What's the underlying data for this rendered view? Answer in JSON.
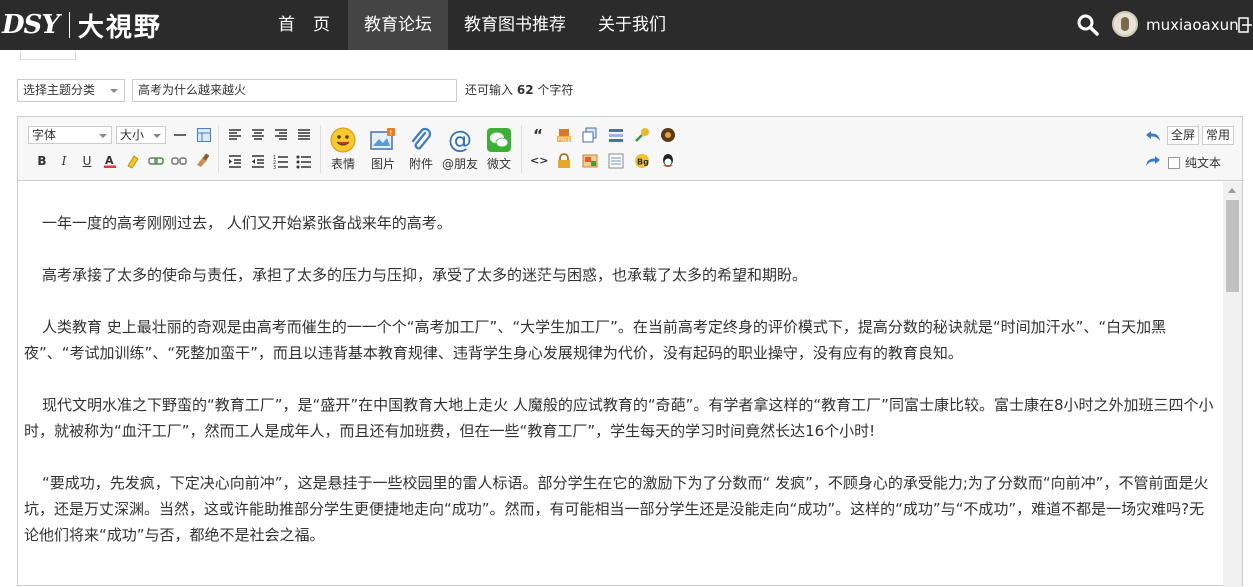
{
  "header": {
    "logo_latin": "DSY",
    "logo_cn": "大視野",
    "nav": [
      {
        "label": "首页"
      },
      {
        "label": "教育论坛"
      },
      {
        "label": "教育图书推荐"
      },
      {
        "label": "关于我们"
      }
    ],
    "username": "muxiaoaxun"
  },
  "form": {
    "category_label": "选择主题分类",
    "title_value": "高考为什么越来越火",
    "remain_prefix": "还可输入",
    "remain_count": "62",
    "remain_suffix": "个字符"
  },
  "toolbar": {
    "font_family": "字体",
    "font_size": "大小",
    "emoji": "表情",
    "image": "图片",
    "attachment": "附件",
    "mention": "@朋友",
    "weixin": "微文",
    "fullscreen": "全屏",
    "common": "常用",
    "plain_text": "纯文本"
  },
  "content": {
    "paragraphs": [
      "一年一度的高考刚刚过去， 人们又开始紧张备战来年的高考。",
      "高考承接了太多的使命与责任，承担了太多的压力与压抑，承受了太多的迷茫与困惑，也承载了太多的希望和期盼。",
      "人类教育 史上最壮丽的奇观是由高考而催生的一一个个“高考加工厂”、“大学生加工厂”。在当前高考定终身的评价模式下，提高分数的秘诀就是“时间加汗水”、“白天加黑夜”、“考试加训练”、“死整加蛮干”，而且以违背基本教育规律、违背学生身心发展规律为代价，没有起码的职业操守，没有应有的教育良知。",
      "现代文明水准之下野蛮的“教育工厂”，是“盛开”在中国教育大地上走火 人魔般的应试教育的“奇葩”。有学者拿这样的“教育工厂”同富士康比较。富士康在8小时之外加班三四个小时，就被称为“血汗工厂”，然而工人是成年人，而且还有加班费，但在一些“教育工厂”，学生每天的学习时间竟然长达16个小时!",
      "“要成功，先发疯，下定决心向前冲”，这是悬挂于一些校园里的雷人标语。部分学生在它的激励下为了分数而“ 发疯”，不顾身心的承受能力;为了分数而“向前冲”，不管前面是火坑，还是万丈深渊。当然，这或许能助推部分学生更便捷地走向“成功”。然而，有可能相当一部分学生还是没能走向“成功”。这样的“成功”与“不成功”，难道不都是一场灾难吗?无论他们将来“成功”与否，都绝不是社会之福。"
    ]
  }
}
